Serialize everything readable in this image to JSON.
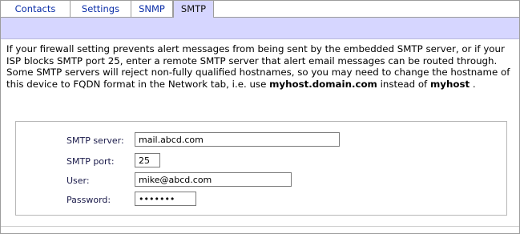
{
  "tabs": [
    {
      "label": "Contacts"
    },
    {
      "label": "Settings"
    },
    {
      "label": "SNMP"
    },
    {
      "label": "SMTP"
    }
  ],
  "active_tab": "SMTP",
  "description": {
    "text1": "If your firewall setting prevents alert messages from being sent by the embedded SMTP server, or if your ISP blocks SMTP port 25, enter a remote SMTP server that alert email messages can be routed through. Some SMTP servers will reject non-fully qualified hostnames, so you may need to change the hostname of this device to FQDN format in the Network tab, i.e. use ",
    "bold1": "myhost.domain.com",
    "text2": " instead of ",
    "bold2": "myhost",
    "text3": " ."
  },
  "form": {
    "smtp_server_label": "SMTP server:",
    "smtp_server_value": "mail.abcd.com",
    "smtp_port_label": "SMTP port:",
    "smtp_port_value": "25",
    "user_label": "User:",
    "user_value": "mike@abcd.com",
    "password_label": "Password:",
    "password_value": "•••••••"
  },
  "colors": {
    "tab_link": "#0b2ea8",
    "active_tab_bg": "#d6d6ff",
    "banner_bg": "#d6d6ff",
    "border": "#9c9c9c"
  }
}
